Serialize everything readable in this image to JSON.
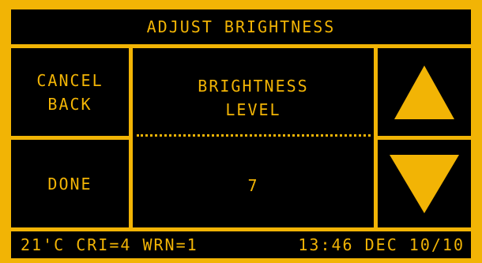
{
  "header": {
    "title": "ADJUST BRIGHTNESS"
  },
  "buttons": {
    "cancel_line1": "CANCEL",
    "cancel_line2": "BACK",
    "done": "DONE",
    "up_icon": "triangle-up-icon",
    "down_icon": "triangle-down-icon"
  },
  "brightness": {
    "label_line1": "BRIGHTNESS",
    "label_line2": "LEVEL",
    "value": "7"
  },
  "status": {
    "left": "21'C CRI=4 WRN=1",
    "right": "13:46 DEC 10/10"
  },
  "colors": {
    "accent": "#f2b405",
    "background": "#000000"
  }
}
